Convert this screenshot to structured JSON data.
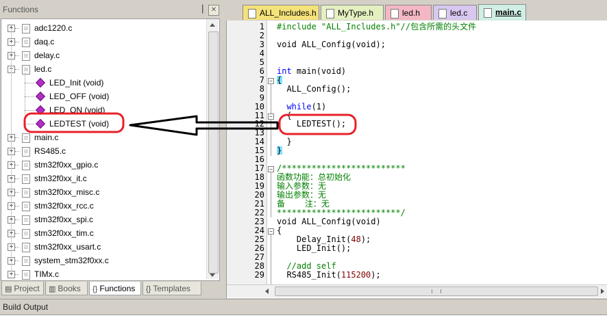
{
  "functions_panel": {
    "title": "Functions",
    "pin_glyph": "▕",
    "close_glyph": "✕"
  },
  "tree": {
    "items": [
      {
        "label": "adc1220.c",
        "type": "file",
        "expander": "+"
      },
      {
        "label": "daq.c",
        "type": "file",
        "expander": "+"
      },
      {
        "label": "delay.c",
        "type": "file",
        "expander": "+"
      },
      {
        "label": "led.c",
        "type": "file",
        "expander": "−"
      },
      {
        "label": "LED_Init (void)",
        "type": "function"
      },
      {
        "label": "LED_OFF (void)",
        "type": "function"
      },
      {
        "label": "LED_ON (void)",
        "type": "function"
      },
      {
        "label": "LEDTEST (void)",
        "type": "function"
      },
      {
        "label": "main.c",
        "type": "file",
        "expander": "+"
      },
      {
        "label": "RS485.c",
        "type": "file",
        "expander": "+"
      },
      {
        "label": "stm32f0xx_gpio.c",
        "type": "file",
        "expander": "+"
      },
      {
        "label": "stm32f0xx_it.c",
        "type": "file",
        "expander": "+"
      },
      {
        "label": "stm32f0xx_misc.c",
        "type": "file",
        "expander": "+"
      },
      {
        "label": "stm32f0xx_rcc.c",
        "type": "file",
        "expander": "+"
      },
      {
        "label": "stm32f0xx_spi.c",
        "type": "file",
        "expander": "+"
      },
      {
        "label": "stm32f0xx_tim.c",
        "type": "file",
        "expander": "+"
      },
      {
        "label": "stm32f0xx_usart.c",
        "type": "file",
        "expander": "+"
      },
      {
        "label": "system_stm32f0xx.c",
        "type": "file",
        "expander": "+"
      },
      {
        "label": "TIMx.c",
        "type": "file",
        "expander": "+"
      }
    ]
  },
  "bottom_tabs": [
    {
      "label": "Project",
      "icon": "▤",
      "active": false
    },
    {
      "label": "Books",
      "icon": "▥",
      "active": false
    },
    {
      "label": "Functions",
      "icon": "{}",
      "active": true
    },
    {
      "label": "Templates",
      "icon": "{}",
      "active": false
    }
  ],
  "editor_tabs": [
    {
      "label": "ALL_Includes.h",
      "color": "#f4e27a"
    },
    {
      "label": "MyType.h",
      "color": "#e4f0c0"
    },
    {
      "label": "led.h",
      "color": "#f4b8c4"
    },
    {
      "label": "led.c",
      "color": "#d8c8f0"
    },
    {
      "label": "main.c",
      "color": "#d0eee4",
      "active": true
    }
  ],
  "code": {
    "lines": [
      {
        "n": "1",
        "parts": [
          {
            "c": "cmt",
            "t": "#include \"ALL_Includes.h\"//包含所需的头文件"
          }
        ]
      },
      {
        "n": "2",
        "parts": []
      },
      {
        "n": "3",
        "parts": [
          {
            "c": "",
            "t": "void ALL_Config(void);"
          }
        ]
      },
      {
        "n": "4",
        "parts": []
      },
      {
        "n": "5",
        "parts": []
      },
      {
        "n": "6",
        "parts": [
          {
            "c": "kw",
            "t": "int"
          },
          {
            "c": "",
            "t": " main(void)"
          }
        ]
      },
      {
        "n": "7",
        "parts": [
          {
            "c": "",
            "t": "{"
          }
        ]
      },
      {
        "n": "8",
        "parts": [
          {
            "c": "",
            "t": "  ALL_Config();"
          }
        ]
      },
      {
        "n": "9",
        "parts": []
      },
      {
        "n": "10",
        "parts": [
          {
            "c": "",
            "t": "  "
          },
          {
            "c": "kw",
            "t": "while"
          },
          {
            "c": "",
            "t": "(1)"
          }
        ]
      },
      {
        "n": "11",
        "parts": [
          {
            "c": "",
            "t": "  {"
          }
        ]
      },
      {
        "n": "12",
        "parts": [
          {
            "c": "",
            "t": "    LEDTEST();"
          }
        ]
      },
      {
        "n": "13",
        "parts": []
      },
      {
        "n": "14",
        "parts": [
          {
            "c": "",
            "t": "  }"
          }
        ]
      },
      {
        "n": "15",
        "parts": [
          {
            "c": "",
            "t": "}"
          }
        ]
      },
      {
        "n": "16",
        "parts": []
      },
      {
        "n": "17",
        "parts": [
          {
            "c": "cmt",
            "t": "/*************************"
          }
        ]
      },
      {
        "n": "18",
        "parts": [
          {
            "c": "cmt",
            "t": "函数功能：总初始化"
          }
        ]
      },
      {
        "n": "19",
        "parts": [
          {
            "c": "cmt",
            "t": "输入参数：无"
          }
        ]
      },
      {
        "n": "20",
        "parts": [
          {
            "c": "cmt",
            "t": "输出参数：无"
          }
        ]
      },
      {
        "n": "21",
        "parts": [
          {
            "c": "cmt",
            "t": "备    注：无"
          }
        ]
      },
      {
        "n": "22",
        "parts": [
          {
            "c": "cmt",
            "t": "*************************/"
          }
        ]
      },
      {
        "n": "23",
        "parts": [
          {
            "c": "",
            "t": "void ALL_Config(void)"
          }
        ]
      },
      {
        "n": "24",
        "parts": [
          {
            "c": "",
            "t": "{"
          }
        ]
      },
      {
        "n": "25",
        "parts": [
          {
            "c": "",
            "t": "    Delay_Init("
          },
          {
            "c": "num",
            "t": "48"
          },
          {
            "c": "",
            "t": ");"
          }
        ]
      },
      {
        "n": "26",
        "parts": [
          {
            "c": "",
            "t": "    LED_Init();"
          }
        ]
      },
      {
        "n": "27",
        "parts": []
      },
      {
        "n": "28",
        "parts": [
          {
            "c": "cmt",
            "t": "  //add self"
          }
        ]
      },
      {
        "n": "29",
        "parts": [
          {
            "c": "",
            "t": "  RS485_Init("
          },
          {
            "c": "num",
            "t": "115200"
          },
          {
            "c": "",
            "t": ");"
          }
        ]
      }
    ]
  },
  "build_output": {
    "title": "Build Output"
  },
  "annotation_color": "#e8202a"
}
